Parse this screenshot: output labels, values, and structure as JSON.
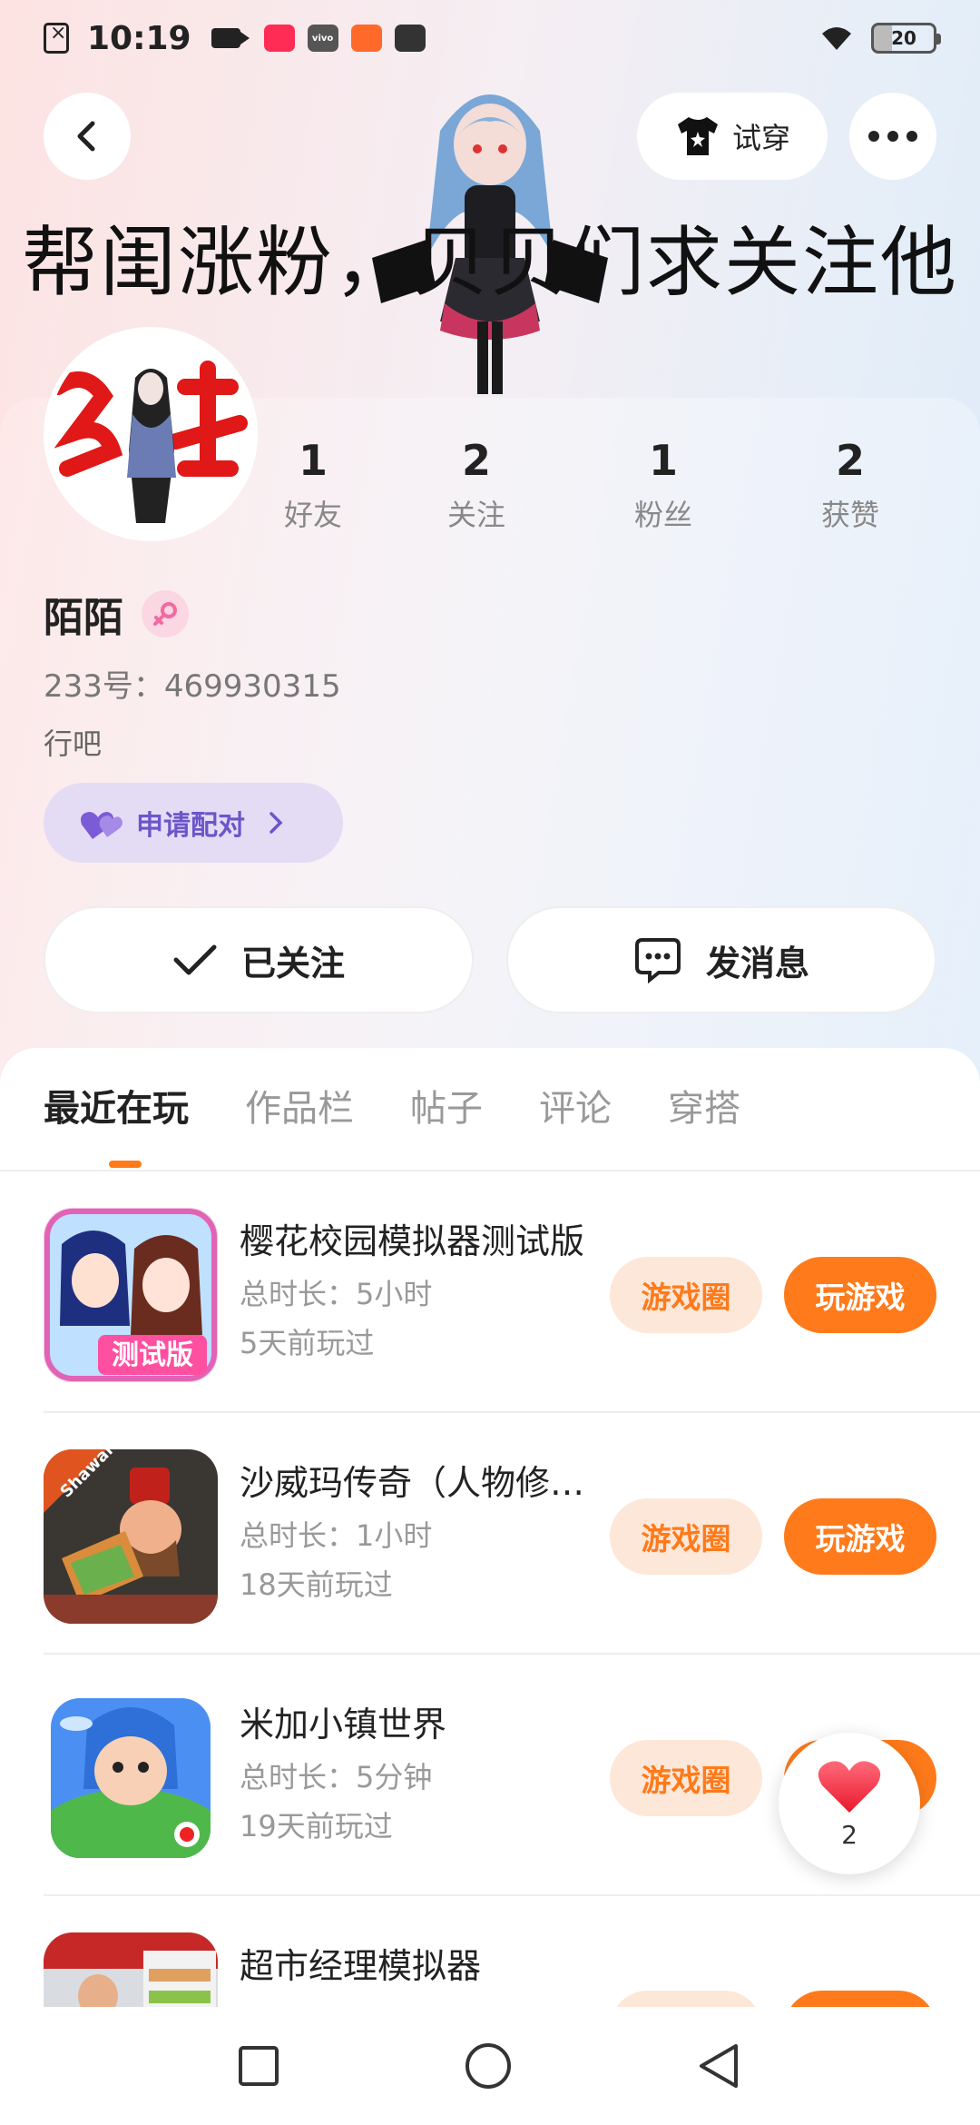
{
  "status_bar": {
    "time": "10:19",
    "battery": "20",
    "app_badges": [
      "vivo"
    ]
  },
  "header": {
    "try_on_label": "试穿",
    "banner_text": "帮闺涨粉，贝贝们求关注他"
  },
  "profile": {
    "avatar_text": "忘本",
    "name": "陌陌",
    "id_line": "233号：469930315",
    "bio": "行吧",
    "pair_label": "申请配对",
    "stats": [
      {
        "num": "1",
        "label": "好友"
      },
      {
        "num": "2",
        "label": "关注"
      },
      {
        "num": "1",
        "label": "粉丝"
      },
      {
        "num": "2",
        "label": "获赞"
      }
    ],
    "follow_label": "已关注",
    "message_label": "发消息"
  },
  "tabs": [
    "最近在玩",
    "作品栏",
    "帖子",
    "评论",
    "穿搭"
  ],
  "games": [
    {
      "title": "樱花校园模拟器测试版",
      "duration": "总时长：5小时",
      "last": "5天前玩过",
      "circle": "游戏圈",
      "play": "玩游戏",
      "icon_badge": "测试版"
    },
    {
      "title": "沙威玛传奇（人物修改版）",
      "duration": "总时长：1小时",
      "last": "18天前玩过",
      "circle": "游戏圈",
      "play": "玩游戏",
      "icon_badge": "Shawarma"
    },
    {
      "title": "米加小镇世界",
      "duration": "总时长：5分钟",
      "last": "19天前玩过",
      "circle": "游戏圈",
      "play": "玩游戏",
      "icon_badge": ""
    },
    {
      "title": "超市经理模拟器",
      "duration": "",
      "last": "",
      "circle": "",
      "play": "",
      "icon_badge": ""
    }
  ],
  "like_float": {
    "count": "2"
  },
  "colors": {
    "accent": "#ff7a1a",
    "pair": "#6c55c9",
    "gender_bg": "#fbd6e3"
  }
}
